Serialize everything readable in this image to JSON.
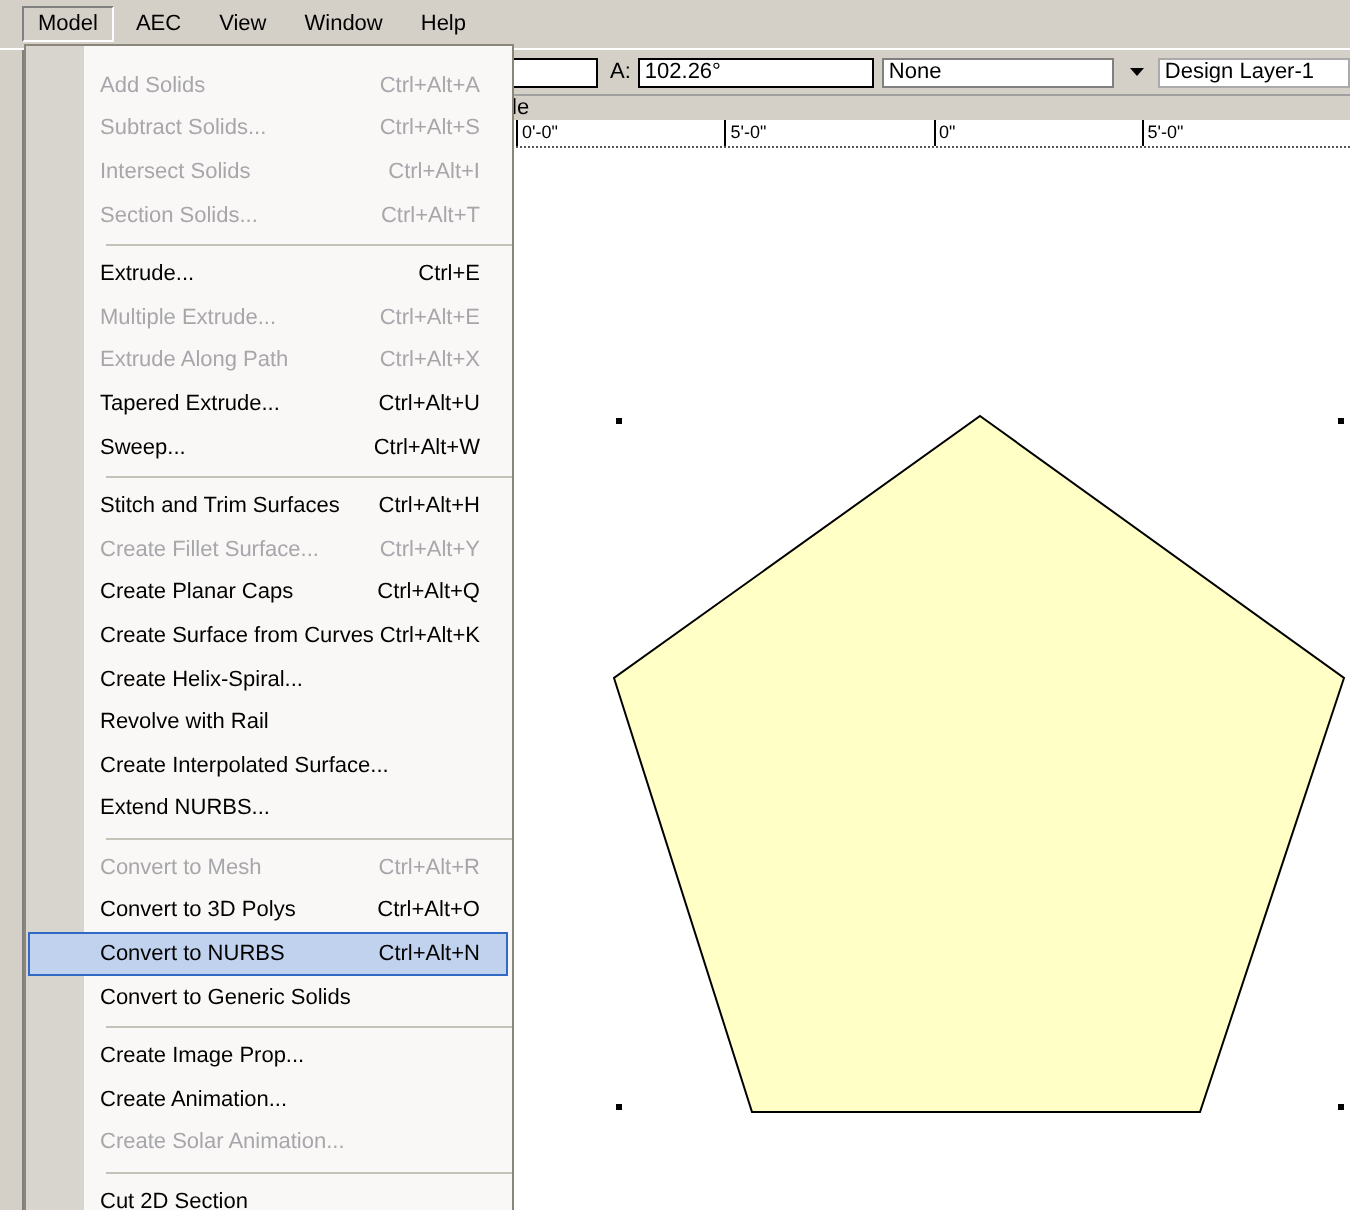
{
  "menubar": [
    {
      "label": "Model",
      "selected": true
    },
    {
      "label": "AEC",
      "selected": false
    },
    {
      "label": "View",
      "selected": false
    },
    {
      "label": "Window",
      "selected": false
    },
    {
      "label": "Help",
      "selected": false
    }
  ],
  "toolbar": {
    "angle_label": "A:",
    "angle_value": "102.26°",
    "class_value": "None",
    "layer_value": "Design Layer-1"
  },
  "tab_fragment": "le",
  "ruler_labels": [
    "0'-0\"",
    "5'-0\"",
    "0\"",
    "5'-0\""
  ],
  "menu": [
    {
      "kind": "item",
      "label": "Add Solids",
      "shortcut": "Ctrl+Alt+A",
      "disabled": true,
      "selected": false
    },
    {
      "kind": "item",
      "label": "Subtract Solids...",
      "shortcut": "Ctrl+Alt+S",
      "disabled": true,
      "selected": false
    },
    {
      "kind": "item",
      "label": "Intersect Solids",
      "shortcut": "Ctrl+Alt+I",
      "disabled": true,
      "selected": false
    },
    {
      "kind": "item",
      "label": "Section Solids...",
      "shortcut": "Ctrl+Alt+T",
      "disabled": true,
      "selected": false
    },
    {
      "kind": "separator"
    },
    {
      "kind": "item",
      "label": "Extrude...",
      "shortcut": "Ctrl+E",
      "disabled": false,
      "selected": false
    },
    {
      "kind": "item",
      "label": "Multiple Extrude...",
      "shortcut": "Ctrl+Alt+E",
      "disabled": true,
      "selected": false
    },
    {
      "kind": "item",
      "label": "Extrude Along Path",
      "shortcut": "Ctrl+Alt+X",
      "disabled": true,
      "selected": false
    },
    {
      "kind": "item",
      "label": "Tapered Extrude...",
      "shortcut": "Ctrl+Alt+U",
      "disabled": false,
      "selected": false
    },
    {
      "kind": "item",
      "label": "Sweep...",
      "shortcut": "Ctrl+Alt+W",
      "disabled": false,
      "selected": false
    },
    {
      "kind": "separator"
    },
    {
      "kind": "item",
      "label": "Stitch and Trim Surfaces",
      "shortcut": "Ctrl+Alt+H",
      "disabled": false,
      "selected": false
    },
    {
      "kind": "item",
      "label": "Create Fillet Surface...",
      "shortcut": "Ctrl+Alt+Y",
      "disabled": true,
      "selected": false
    },
    {
      "kind": "item",
      "label": "Create Planar Caps",
      "shortcut": "Ctrl+Alt+Q",
      "disabled": false,
      "selected": false
    },
    {
      "kind": "item",
      "label": "Create Surface from Curves",
      "shortcut": "Ctrl+Alt+K",
      "disabled": false,
      "selected": false
    },
    {
      "kind": "item",
      "label": "Create Helix-Spiral...",
      "disabled": false,
      "selected": false
    },
    {
      "kind": "item",
      "label": "Revolve with Rail",
      "disabled": false,
      "selected": false
    },
    {
      "kind": "item",
      "label": "Create Interpolated Surface...",
      "disabled": false,
      "selected": false
    },
    {
      "kind": "item",
      "label": "Extend NURBS...",
      "disabled": false,
      "selected": false
    },
    {
      "kind": "separator"
    },
    {
      "kind": "item",
      "label": "Convert to Mesh",
      "shortcut": "Ctrl+Alt+R",
      "disabled": true,
      "selected": false
    },
    {
      "kind": "item",
      "label": "Convert to 3D Polys",
      "shortcut": "Ctrl+Alt+O",
      "disabled": false,
      "selected": false
    },
    {
      "kind": "item",
      "label": "Convert to NURBS",
      "shortcut": "Ctrl+Alt+N",
      "disabled": false,
      "selected": true
    },
    {
      "kind": "item",
      "label": "Convert to Generic Solids",
      "disabled": false,
      "selected": false
    },
    {
      "kind": "separator"
    },
    {
      "kind": "item",
      "label": "Create Image Prop...",
      "disabled": false,
      "selected": false
    },
    {
      "kind": "item",
      "label": "Create Animation...",
      "disabled": false,
      "selected": false
    },
    {
      "kind": "item",
      "label": "Create Solar Animation...",
      "disabled": true,
      "selected": false
    },
    {
      "kind": "separator"
    },
    {
      "kind": "item",
      "label": "Cut 2D Section",
      "disabled": false,
      "selected": false
    }
  ]
}
